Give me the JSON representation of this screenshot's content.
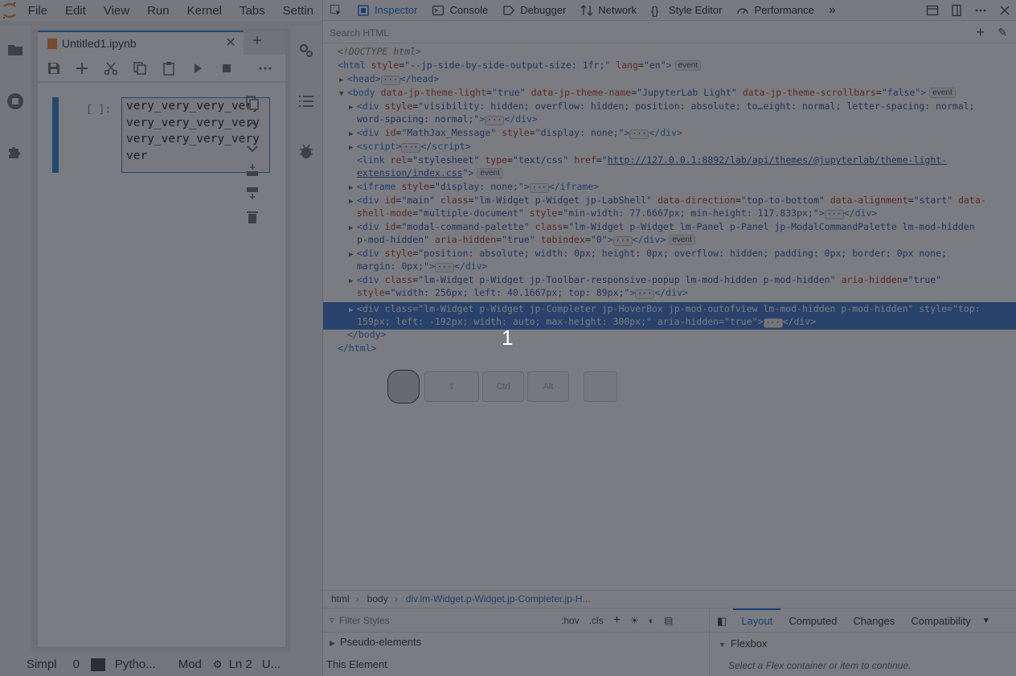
{
  "jupyter": {
    "menu": [
      "File",
      "Edit",
      "View",
      "Run",
      "Kernel",
      "Tabs",
      "Settin"
    ],
    "tab": {
      "title": "Untitled1.ipynb"
    },
    "cell": {
      "prompt": "[ ]:",
      "lines": [
        "very_very_very_very",
        "very_very_very_very",
        "very_very_very_very",
        "ver"
      ]
    },
    "status": {
      "mode": "Simpl",
      "count": "0",
      "kernel": "Pytho...",
      "edit_mode": "Mod",
      "line": "Ln 2",
      "encoding": "U..."
    }
  },
  "devtools": {
    "tabs": [
      {
        "label": "Inspector",
        "icon": "inspector-icon"
      },
      {
        "label": "Console",
        "icon": "console-icon"
      },
      {
        "label": "Debugger",
        "icon": "debugger-icon"
      },
      {
        "label": "Network",
        "icon": "network-icon"
      },
      {
        "label": "Style Editor",
        "icon": "style-editor-icon"
      },
      {
        "label": "Performance",
        "icon": "performance-icon"
      }
    ],
    "search_placeholder": "Search HTML",
    "markup": {
      "doctype": "<!DOCTYPE html>",
      "html_open": "html",
      "html_attrs": [
        {
          "name": "style",
          "value": "--jp-side-by-side-output-size: 1fr;"
        },
        {
          "name": "lang",
          "value": "en"
        }
      ],
      "head": "head",
      "body_attrs": [
        {
          "name": "data-jp-theme-light",
          "value": "true"
        },
        {
          "name": "data-jp-theme-name",
          "value": "JupyterLab Light"
        },
        {
          "name": "data-jp-theme-scrollbars",
          "value": "false"
        }
      ],
      "div1_style_l1": "visibility: hidden; overflow: hidden; position: absolute; to…eight: normal; letter-spacing: normal;",
      "div1_style_l2": "word-spacing: normal;",
      "mathjax_id": "MathJax_Message",
      "mathjax_style": "display: none;",
      "link_rel": "stylesheet",
      "link_type": "text/css",
      "link_href_l1": "http://127.0.0.1:8892/lab/api/themes/@jupyterlab/theme-light-",
      "link_href_l2": "extension/index.css",
      "iframe_style": "display: none;",
      "main_id": "main",
      "main_class": "lm-Widget p-Widget jp-LabShell",
      "main_dir": "top-to-bottom",
      "main_align": "start",
      "main_shell_l1": "data-",
      "main_shell_attr": "shell-mode",
      "main_shell_val": "multiple-document",
      "main_style": "min-width: 77.6667px; min-height: 117.833px;",
      "modal_id": "modal-command-palette",
      "modal_class_l1": "lm-Widget p-Widget lm-Panel p-Panel jp-ModalCommandPalette lm-mod-hidden",
      "modal_class_l2": "p-mod-hidden",
      "modal_aria": "true",
      "modal_tab": "0",
      "div4_style_l1": "position: absolute; width: 0px; height: 0px; overflow: hidden; padding: 0px; border: 0px none;",
      "div4_style_l2": "margin: 0px;",
      "popup_class": "lm-Widget p-Widget jp-Toolbar-responsive-popup lm-mod-hidden p-mod-hidden",
      "popup_aria": "true",
      "popup_style": "width: 256px; left: 40.1667px; top: 89px;",
      "sel_class": "lm-Widget p-Widget jp-Completer jp-HoverBox jp-mod-outofview lm-mod-hidden p-mod-hidden",
      "sel_style_l1": "top:",
      "sel_style_l2": "159px; left: -192px; width: auto; max-height: 300px;",
      "sel_aria": "true",
      "body_close": "</body>",
      "html_close": "</html>",
      "badge": "event"
    },
    "overlay_number": "1",
    "breadcrumbs": [
      "html",
      "body",
      "div.lm-Widget.p-Widget.jp-Completer.jp-H..."
    ],
    "rules": {
      "filter_placeholder": "Filter Styles",
      "hov": ":hov",
      "cls": ".cls",
      "pseudo": "Pseudo-elements",
      "this_element": "This Element"
    },
    "sidepanel": {
      "tabs": [
        "Layout",
        "Computed",
        "Changes",
        "Compatibility"
      ],
      "flexbox": "Flexbox",
      "flexbox_msg": "Select a Flex container or item to continue."
    },
    "keys": [
      "Ctrl",
      "Alt"
    ]
  }
}
